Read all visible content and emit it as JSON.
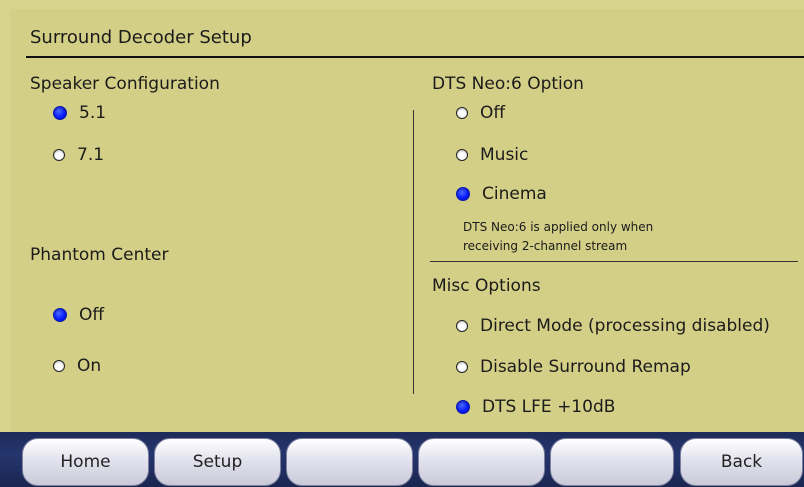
{
  "title": "Surround Decoder Setup",
  "speaker_config": {
    "label": "Speaker Configuration",
    "options": [
      {
        "label": "5.1",
        "selected": true
      },
      {
        "label": "7.1",
        "selected": false
      }
    ]
  },
  "phantom_center": {
    "label": "Phantom Center",
    "options": [
      {
        "label": "Off",
        "selected": true
      },
      {
        "label": "On",
        "selected": false
      }
    ]
  },
  "dts_neo6": {
    "label": "DTS Neo:6 Option",
    "options": [
      {
        "label": "Off",
        "selected": false
      },
      {
        "label": "Music",
        "selected": false
      },
      {
        "label": "Cinema",
        "selected": true
      }
    ],
    "note_line1": "DTS Neo:6 is applied only when",
    "note_line2": "receiving 2-channel stream"
  },
  "misc": {
    "label": "Misc Options",
    "options": [
      {
        "label": "Direct Mode (processing disabled)",
        "selected": false
      },
      {
        "label": "Disable Surround Remap",
        "selected": false
      },
      {
        "label": "DTS LFE +10dB",
        "selected": true
      }
    ]
  },
  "bottom_buttons": [
    "Home",
    "Setup",
    "",
    "",
    "",
    "Back"
  ],
  "colors": {
    "panel": "#d3cf87",
    "radio_selected": "#0b1dff",
    "bottom_bar": "#1d2b5a"
  }
}
